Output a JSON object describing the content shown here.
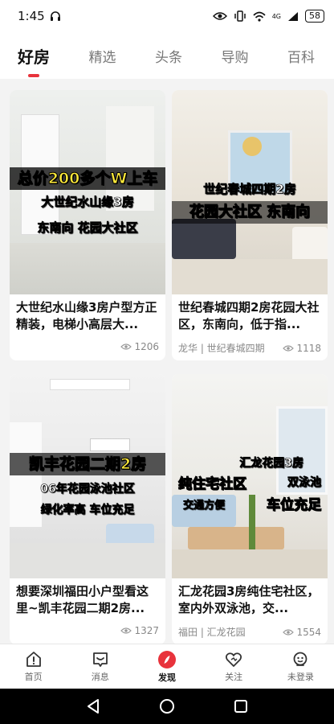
{
  "status": {
    "time": "1:45",
    "battery": "58",
    "network": "4G"
  },
  "tabs": [
    {
      "label": "好房",
      "active": true
    },
    {
      "label": "精选"
    },
    {
      "label": "头条"
    },
    {
      "label": "导购"
    },
    {
      "label": "百科"
    }
  ],
  "cards": [
    {
      "overlay": [
        "总价200多个W上车",
        "大世纪水山缘3房",
        "东南向 花园大社区"
      ],
      "title": "大世纪水山缘3房户型方正精装，电梯小高层大...",
      "location": "",
      "views": "1206"
    },
    {
      "overlay": [
        "世纪春城四期2房",
        "花园大社区 东南向"
      ],
      "title": "世纪春城四期2房花园大社区，东南向，低于指...",
      "location": "龙华 | 世纪春城四期",
      "views": "1118"
    },
    {
      "overlay": [
        "凯丰花园二期2房",
        "06年花园泳池社区",
        "绿化率高 车位充足"
      ],
      "title": "想要深圳福田小户型看这里~凯丰花园二期2房...",
      "location": "",
      "views": "1327"
    },
    {
      "overlay": [
        "汇龙花园3房",
        "纯住宅社区",
        "双泳池",
        "交通方便",
        "车位充足"
      ],
      "title": "汇龙花园3房纯住宅社区，室内外双泳池，交...",
      "location": "福田 | 汇龙花园",
      "views": "1554"
    }
  ],
  "bottom_nav": [
    {
      "label": "首页",
      "icon": "home-icon"
    },
    {
      "label": "消息",
      "icon": "message-icon"
    },
    {
      "label": "发现",
      "icon": "discover-icon",
      "active": true
    },
    {
      "label": "关注",
      "icon": "heart-icon"
    },
    {
      "label": "未登录",
      "icon": "user-icon"
    }
  ],
  "colors": {
    "accent": "#e8333c",
    "overlay_yellow": "#ffea3a"
  }
}
